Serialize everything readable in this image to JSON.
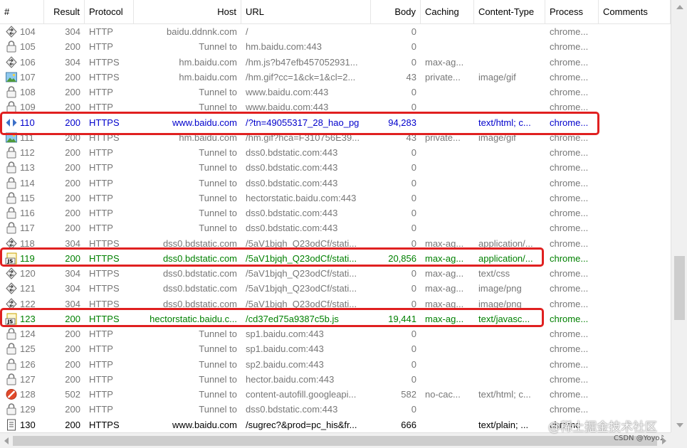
{
  "columns": {
    "num": "#",
    "result": "Result",
    "protocol": "Protocol",
    "host": "Host",
    "url": "URL",
    "body": "Body",
    "caching": "Caching",
    "content_type": "Content-Type",
    "process": "Process",
    "comments": "Comments"
  },
  "rows": [
    {
      "num": "104",
      "result": "304",
      "protocol": "HTTP",
      "host": "baidu.ddnnk.com",
      "url": "/",
      "body": "0",
      "caching": "",
      "content_type": "",
      "process": "chrome...",
      "comments": "",
      "icon": "diamond-arrows-icon",
      "style": "gray"
    },
    {
      "num": "105",
      "result": "200",
      "protocol": "HTTP",
      "host": "Tunnel to",
      "url": "hm.baidu.com:443",
      "body": "0",
      "caching": "",
      "content_type": "",
      "process": "chrome...",
      "comments": "",
      "icon": "lock-icon",
      "style": "gray"
    },
    {
      "num": "106",
      "result": "304",
      "protocol": "HTTPS",
      "host": "hm.baidu.com",
      "url": "/hm.js?b47efb457052931...",
      "body": "0",
      "caching": "max-ag...",
      "content_type": "",
      "process": "chrome...",
      "comments": "",
      "icon": "diamond-arrows-icon",
      "style": "gray"
    },
    {
      "num": "107",
      "result": "200",
      "protocol": "HTTPS",
      "host": "hm.baidu.com",
      "url": "/hm.gif?cc=1&ck=1&cl=2...",
      "body": "43",
      "caching": "private...",
      "content_type": "image/gif",
      "process": "chrome...",
      "comments": "",
      "icon": "image-icon",
      "style": "gray"
    },
    {
      "num": "108",
      "result": "200",
      "protocol": "HTTP",
      "host": "Tunnel to",
      "url": "www.baidu.com:443",
      "body": "0",
      "caching": "",
      "content_type": "",
      "process": "chrome...",
      "comments": "",
      "icon": "lock-icon",
      "style": "gray"
    },
    {
      "num": "109",
      "result": "200",
      "protocol": "HTTP",
      "host": "Tunnel to",
      "url": "www.baidu.com:443",
      "body": "0",
      "caching": "",
      "content_type": "",
      "process": "chrome...",
      "comments": "",
      "icon": "lock-icon",
      "style": "gray"
    },
    {
      "num": "110",
      "result": "200",
      "protocol": "HTTPS",
      "host": "www.baidu.com",
      "url": "/?tn=49055317_28_hao_pg",
      "body": "94,283",
      "caching": "",
      "content_type": "text/html; c...",
      "process": "chrome...",
      "comments": "",
      "icon": "html-code-icon",
      "style": "blue"
    },
    {
      "num": "111",
      "result": "200",
      "protocol": "HTTPS",
      "host": "hm.baidu.com",
      "url": "/hm.gif?hca=F310756E39...",
      "body": "43",
      "caching": "private...",
      "content_type": "image/gif",
      "process": "chrome...",
      "comments": "",
      "icon": "image-icon",
      "style": "gray"
    },
    {
      "num": "112",
      "result": "200",
      "protocol": "HTTP",
      "host": "Tunnel to",
      "url": "dss0.bdstatic.com:443",
      "body": "0",
      "caching": "",
      "content_type": "",
      "process": "chrome...",
      "comments": "",
      "icon": "lock-icon",
      "style": "gray"
    },
    {
      "num": "113",
      "result": "200",
      "protocol": "HTTP",
      "host": "Tunnel to",
      "url": "dss0.bdstatic.com:443",
      "body": "0",
      "caching": "",
      "content_type": "",
      "process": "chrome...",
      "comments": "",
      "icon": "lock-icon",
      "style": "gray"
    },
    {
      "num": "114",
      "result": "200",
      "protocol": "HTTP",
      "host": "Tunnel to",
      "url": "dss0.bdstatic.com:443",
      "body": "0",
      "caching": "",
      "content_type": "",
      "process": "chrome...",
      "comments": "",
      "icon": "lock-icon",
      "style": "gray"
    },
    {
      "num": "115",
      "result": "200",
      "protocol": "HTTP",
      "host": "Tunnel to",
      "url": "hectorstatic.baidu.com:443",
      "body": "0",
      "caching": "",
      "content_type": "",
      "process": "chrome...",
      "comments": "",
      "icon": "lock-icon",
      "style": "gray"
    },
    {
      "num": "116",
      "result": "200",
      "protocol": "HTTP",
      "host": "Tunnel to",
      "url": "dss0.bdstatic.com:443",
      "body": "0",
      "caching": "",
      "content_type": "",
      "process": "chrome...",
      "comments": "",
      "icon": "lock-icon",
      "style": "gray"
    },
    {
      "num": "117",
      "result": "200",
      "protocol": "HTTP",
      "host": "Tunnel to",
      "url": "dss0.bdstatic.com:443",
      "body": "0",
      "caching": "",
      "content_type": "",
      "process": "chrome...",
      "comments": "",
      "icon": "lock-icon",
      "style": "gray"
    },
    {
      "num": "118",
      "result": "304",
      "protocol": "HTTPS",
      "host": "dss0.bdstatic.com",
      "url": "/5aV1bjqh_Q23odCf/stati...",
      "body": "0",
      "caching": "max-ag...",
      "content_type": "application/...",
      "process": "chrome...",
      "comments": "",
      "icon": "diamond-arrows-icon",
      "style": "gray"
    },
    {
      "num": "119",
      "result": "200",
      "protocol": "HTTPS",
      "host": "dss0.bdstatic.com",
      "url": "/5aV1bjqh_Q23odCf/stati...",
      "body": "20,856",
      "caching": "max-ag...",
      "content_type": "application/...",
      "process": "chrome...",
      "comments": "",
      "icon": "js-file-icon",
      "style": "green"
    },
    {
      "num": "120",
      "result": "304",
      "protocol": "HTTPS",
      "host": "dss0.bdstatic.com",
      "url": "/5aV1bjqh_Q23odCf/stati...",
      "body": "0",
      "caching": "max-ag...",
      "content_type": "text/css",
      "process": "chrome...",
      "comments": "",
      "icon": "diamond-arrows-icon",
      "style": "gray"
    },
    {
      "num": "121",
      "result": "304",
      "protocol": "HTTPS",
      "host": "dss0.bdstatic.com",
      "url": "/5aV1bjqh_Q23odCf/stati...",
      "body": "0",
      "caching": "max-ag...",
      "content_type": "image/png",
      "process": "chrome...",
      "comments": "",
      "icon": "diamond-arrows-icon",
      "style": "gray"
    },
    {
      "num": "122",
      "result": "304",
      "protocol": "HTTPS",
      "host": "dss0.bdstatic.com",
      "url": "/5aV1bjqh_Q23odCf/stati...",
      "body": "0",
      "caching": "max-ag...",
      "content_type": "image/png",
      "process": "chrome...",
      "comments": "",
      "icon": "diamond-arrows-icon",
      "style": "gray"
    },
    {
      "num": "123",
      "result": "200",
      "protocol": "HTTPS",
      "host": "hectorstatic.baidu.c...",
      "url": "/cd37ed75a9387c5b.js",
      "body": "19,441",
      "caching": "max-ag...",
      "content_type": "text/javasc...",
      "process": "chrome...",
      "comments": "",
      "icon": "js-file-icon",
      "style": "green"
    },
    {
      "num": "124",
      "result": "200",
      "protocol": "HTTP",
      "host": "Tunnel to",
      "url": "sp1.baidu.com:443",
      "body": "0",
      "caching": "",
      "content_type": "",
      "process": "chrome...",
      "comments": "",
      "icon": "lock-icon",
      "style": "gray"
    },
    {
      "num": "125",
      "result": "200",
      "protocol": "HTTP",
      "host": "Tunnel to",
      "url": "sp1.baidu.com:443",
      "body": "0",
      "caching": "",
      "content_type": "",
      "process": "chrome...",
      "comments": "",
      "icon": "lock-icon",
      "style": "gray"
    },
    {
      "num": "126",
      "result": "200",
      "protocol": "HTTP",
      "host": "Tunnel to",
      "url": "sp2.baidu.com:443",
      "body": "0",
      "caching": "",
      "content_type": "",
      "process": "chrome...",
      "comments": "",
      "icon": "lock-icon",
      "style": "gray"
    },
    {
      "num": "127",
      "result": "200",
      "protocol": "HTTP",
      "host": "Tunnel to",
      "url": "hector.baidu.com:443",
      "body": "0",
      "caching": "",
      "content_type": "",
      "process": "chrome...",
      "comments": "",
      "icon": "lock-icon",
      "style": "gray"
    },
    {
      "num": "128",
      "result": "502",
      "protocol": "HTTP",
      "host": "Tunnel to",
      "url": "content-autofill.googleapi...",
      "body": "582",
      "caching": "no-cac...",
      "content_type": "text/html; c...",
      "process": "chrome...",
      "comments": "",
      "icon": "error-icon",
      "style": "gray"
    },
    {
      "num": "129",
      "result": "200",
      "protocol": "HTTP",
      "host": "Tunnel to",
      "url": "dss0.bdstatic.com:443",
      "body": "0",
      "caching": "",
      "content_type": "",
      "process": "chrome...",
      "comments": "",
      "icon": "lock-icon",
      "style": "gray"
    },
    {
      "num": "130",
      "result": "200",
      "protocol": "HTTPS",
      "host": "www.baidu.com",
      "url": "/sugrec?&prod=pc_his&fr...",
      "body": "666",
      "caching": "",
      "content_type": "text/plain; ...",
      "process": "chrome",
      "comments": "",
      "icon": "document-icon",
      "style": "black"
    }
  ],
  "highlighted_rows": [
    "110",
    "119",
    "123"
  ],
  "colors": {
    "gray_text": "#777777",
    "blue_text": "#0000cc",
    "green_text": "#008000",
    "highlight_border": "#e02020"
  },
  "watermark": {
    "main": "@稀土掘金技术社区",
    "sub": "CSDN @Yoyo♪"
  }
}
